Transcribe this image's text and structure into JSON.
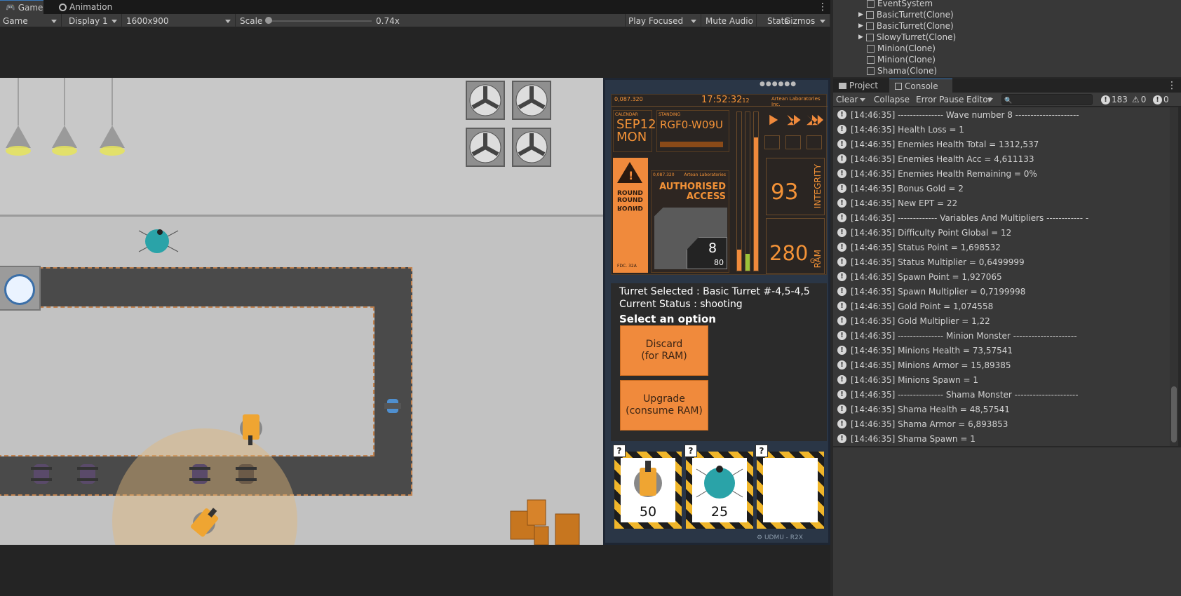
{
  "game_tabs": [
    {
      "label": "Game",
      "icon": "gamepad-icon",
      "active": true
    },
    {
      "label": "Animation",
      "icon": "animation-clock-icon",
      "active": false
    }
  ],
  "toolbar": {
    "view": "Game",
    "display": "Display 1",
    "resolution": "1600x900",
    "scale_label": "Scale",
    "scale_value": "0.74x",
    "scale_fraction": 0.0,
    "play_mode": "Play Focused",
    "mute": "Mute Audio",
    "stats": "Stats",
    "gizmos": "Gizmos"
  },
  "hierarchy": [
    {
      "label": "EventSystem",
      "expandable": false
    },
    {
      "label": "BasicTurret(Clone)",
      "expandable": true
    },
    {
      "label": "BasicTurret(Clone)",
      "expandable": true
    },
    {
      "label": "SlowyTurret(Clone)",
      "expandable": true
    },
    {
      "label": "Minion(Clone)",
      "expandable": false
    },
    {
      "label": "Minion(Clone)",
      "expandable": false
    },
    {
      "label": "Shama(Clone)",
      "expandable": false
    }
  ],
  "hud": {
    "top_code": "0,087.320",
    "clock": "17:52:32",
    "clock_sub": "12",
    "lab": "Artean Laboratories Inc.",
    "date_label": "CALENDAR",
    "date_line1": "SEP12",
    "date_line2": "MON",
    "code_label": "STANDING",
    "code": "RGF0-W09U",
    "round_text_1": "ROUND",
    "round_text_2": "ROUND",
    "round_text_3": "ROUND",
    "fdc": "FDC. 32A",
    "card_code": "0,087.320",
    "card_lab": "Artean Laboratories",
    "access_1": "AUTHORISED",
    "access_2": "ACCESS",
    "card_num": "8",
    "card_sub": "80",
    "integrity_val": "93",
    "integrity_label": "INTEGRITY",
    "ram_val": "280",
    "ram_unit": "G",
    "ram_label": "RAM"
  },
  "selection": {
    "turret_line": "Turret Selected : Basic Turret #-4,5-4,5",
    "status_line": "Current Status :  shooting",
    "prompt": "Select an option",
    "discard_1": "Discard",
    "discard_2": "(for RAM)",
    "upgrade_1": "Upgrade",
    "upgrade_2": "(consume RAM)"
  },
  "shop": [
    {
      "price": "50",
      "q": "?"
    },
    {
      "price": "25",
      "q": "?"
    },
    {
      "price": "",
      "q": "?"
    }
  ],
  "panel_footer": "UDMU - R2X",
  "console_tabs": [
    {
      "label": "Project",
      "icon": "folder-icon"
    },
    {
      "label": "Console",
      "icon": "console-icon",
      "active": true
    }
  ],
  "console_bar": {
    "clear": "Clear",
    "collapse": "Collapse",
    "error_pause": "Error Pause",
    "editor": "Editor",
    "search_placeholder": "",
    "count_log": "183",
    "count_warn": "0",
    "count_err": "0"
  },
  "logs": [
    "[14:46:35] --------------- Wave number 8 ---------------------",
    "[14:46:35] Health Loss = 1",
    "[14:46:35] Enemies Health Total = 1312,537",
    "[14:46:35] Enemies Health Acc = 4,611133",
    "[14:46:35] Enemies Health Remaining = 0%",
    "[14:46:35] Bonus Gold = 2",
    "[14:46:35] New EPT = 22",
    "[14:46:35] ------------- Variables And Multipliers ------------ -",
    "[14:46:35] Difficulty Point Global = 12",
    "[14:46:35] Status Point = 1,698532",
    "[14:46:35] Status Multiplier = 0,6499999",
    "[14:46:35] Spawn Point = 1,927065",
    "[14:46:35] Spawn Multiplier = 0,7199998",
    "[14:46:35] Gold Point = 1,074558",
    "[14:46:35] Gold Multiplier = 1,22",
    "[14:46:35] --------------- Minion Monster ---------------------",
    "[14:46:35] Minions Health = 73,57541",
    "[14:46:35] Minions Armor = 15,89385",
    "[14:46:35] Minions Spawn = 1",
    "[14:46:35] --------------- Shama Monster ---------------------",
    "[14:46:35] Shama Health = 48,57541",
    "[14:46:35] Shama Armor = 6,893853",
    "[14:46:35] Shama Spawn = 1"
  ]
}
